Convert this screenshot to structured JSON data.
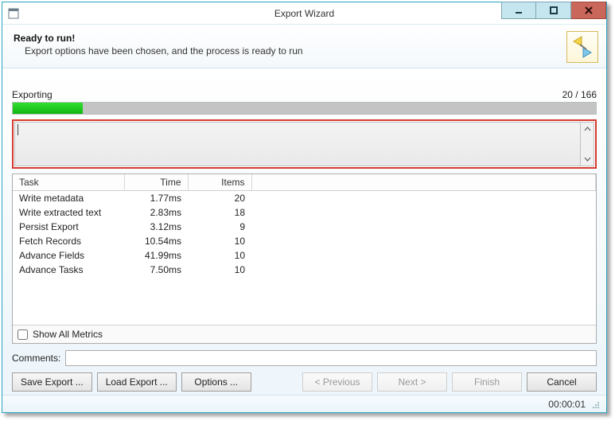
{
  "window": {
    "title": "Export Wizard"
  },
  "header": {
    "title": "Ready to run!",
    "subtitle": "Export options have been chosen, and the process is ready to run"
  },
  "progress": {
    "label": "Exporting",
    "current": 20,
    "total": 166,
    "counter": "20 / 166",
    "percent": 12
  },
  "log_text": "",
  "metrics": {
    "columns": {
      "task": "Task",
      "time": "Time",
      "items": "Items"
    },
    "rows": [
      {
        "task": "Write metadata",
        "time": "1.77ms",
        "items": "20"
      },
      {
        "task": "Write extracted text",
        "time": "2.83ms",
        "items": "18"
      },
      {
        "task": "Persist Export",
        "time": "3.12ms",
        "items": "9"
      },
      {
        "task": "Fetch Records",
        "time": "10.54ms",
        "items": "10"
      },
      {
        "task": "Advance Fields",
        "time": "41.99ms",
        "items": "10"
      },
      {
        "task": "Advance Tasks",
        "time": "7.50ms",
        "items": "10"
      }
    ],
    "show_all_label": "Show All Metrics",
    "show_all_checked": false
  },
  "comments": {
    "label": "Comments:",
    "value": ""
  },
  "buttons": {
    "save_export": "Save Export ...",
    "load_export": "Load Export ...",
    "options": "Options ...",
    "previous": "< Previous",
    "next": "Next >",
    "finish": "Finish",
    "cancel": "Cancel"
  },
  "status": {
    "elapsed": "00:00:01"
  }
}
